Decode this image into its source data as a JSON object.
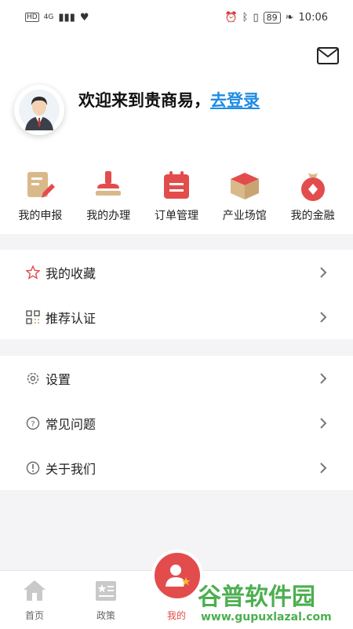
{
  "status": {
    "network": "4G",
    "battery": "89",
    "time": "10:06"
  },
  "header": {
    "welcome": "欢迎来到贵商易，",
    "login_link": "去登录"
  },
  "quick_actions": [
    {
      "label": "我的申报",
      "icon": "edit-document-icon"
    },
    {
      "label": "我的办理",
      "icon": "stamp-icon"
    },
    {
      "label": "订单管理",
      "icon": "calendar-list-icon"
    },
    {
      "label": "产业场馆",
      "icon": "box-icon"
    },
    {
      "label": "我的金融",
      "icon": "money-bag-icon"
    }
  ],
  "menu_group1": [
    {
      "label": "我的收藏",
      "icon": "star-icon"
    },
    {
      "label": "推荐认证",
      "icon": "qr-code-icon"
    }
  ],
  "menu_group2": [
    {
      "label": "设置",
      "icon": "gear-icon"
    },
    {
      "label": "常见问题",
      "icon": "question-icon"
    },
    {
      "label": "关于我们",
      "icon": "info-icon"
    }
  ],
  "tabs": [
    {
      "label": "首页",
      "icon": "home-icon"
    },
    {
      "label": "政策",
      "icon": "policy-icon"
    },
    {
      "label": "我的",
      "icon": "user-icon"
    }
  ],
  "watermark": {
    "title": "谷普软件园",
    "url": "www.gupuxlazal.com"
  },
  "colors": {
    "accent_red": "#e34c4c",
    "link_blue": "#1e8ce4",
    "tan": "#d9b98a"
  }
}
